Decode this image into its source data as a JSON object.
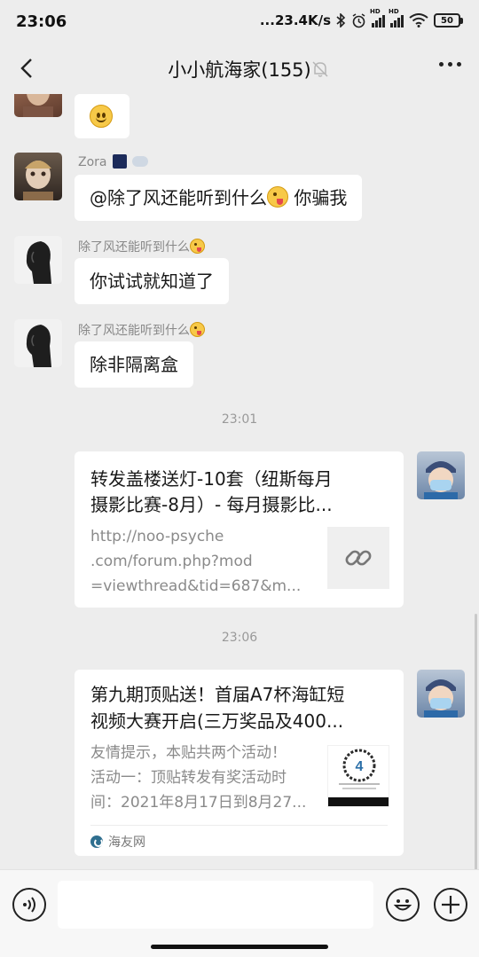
{
  "status_bar": {
    "time": "23:06",
    "net_speed": "...23.4K/s",
    "battery": "50"
  },
  "header": {
    "title": "小小航海家(155)"
  },
  "messages": [
    {
      "side": "left",
      "content": "smile emoji only"
    },
    {
      "side": "left",
      "sender": "Zora",
      "text": "@除了风还能听到什么",
      "text_after": "你骗我"
    },
    {
      "side": "left",
      "sender": "除了风还能听到什么",
      "text": "你试试就知道了"
    },
    {
      "side": "left",
      "sender": "除了风还能听到什么",
      "text": "除非隔离盒"
    }
  ],
  "timestamps": [
    "23:01",
    "23:06"
  ],
  "link_cards": [
    {
      "title_lines": [
        "转发盖楼送灯-10套（纽斯每月",
        "摄影比赛-8月）- 每月摄影比..."
      ],
      "desc_lines": [
        "http://noo-psyche",
        ".com/forum.php?mod",
        "=viewthread&tid=687&m..."
      ],
      "thumb_icon": "link-icon"
    },
    {
      "title_lines": [
        "第九期顶贴送！首届A7杯海缸短",
        "视频大赛开启(三万奖品及400..."
      ],
      "desc_lines": [
        "友情提示，本贴共两个活动！",
        "活动一：顶贴转发有奖活动时",
        "间：2021年8月17日到8月27..."
      ],
      "source": "海友网"
    }
  ]
}
